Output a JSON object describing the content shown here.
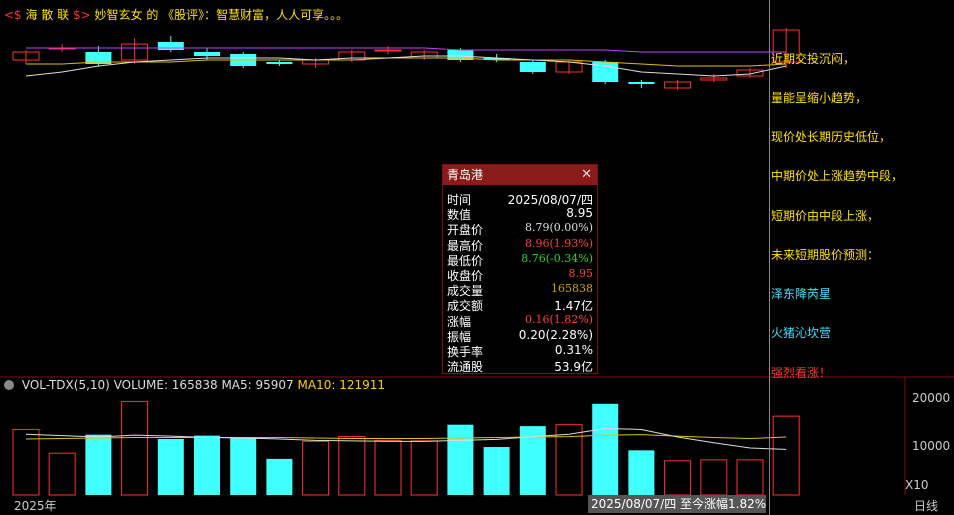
{
  "header": {
    "brand_prefix": "<$ ",
    "brand_text": "海 散 联",
    "brand_suffix": " $>",
    "tagline": "妙智玄女  的 《股评》：智慧财富，人人可享。。。"
  },
  "predictions": [
    {
      "text": "近期交投沉闷，",
      "color": "#ffe000"
    },
    {
      "text": "量能呈缩小趋势，",
      "color": "#ffe000"
    },
    {
      "text": "现价处长期历史低位，",
      "color": "#ffe000"
    },
    {
      "text": "中期价处上涨趋势中段，",
      "color": "#ffe000"
    },
    {
      "text": "短期价由中段上涨，",
      "color": "#ffe000"
    },
    {
      "text": "未来短期股价预测：",
      "color": "#ffe000"
    },
    {
      "text": "泽东降芮星",
      "color": "#40e0ff"
    },
    {
      "text": "火猪沁坎营",
      "color": "#40e0ff"
    },
    {
      "text": "强烈看涨！",
      "color": "#ff3030"
    }
  ],
  "info": {
    "title": "青岛港",
    "close_icon": "close-icon",
    "rows": [
      {
        "k": "时间",
        "v": "2025/08/07/四",
        "color": "#ffffff",
        "sans": true
      },
      {
        "k": "数值",
        "v": "8.95",
        "color": "#ffffff",
        "sans": true
      },
      {
        "k": "开盘价",
        "v": "8.79(0.00%)",
        "color": "#dddddd",
        "sans": false
      },
      {
        "k": "最高价",
        "v": "8.96(1.93%)",
        "color": "#ff4040",
        "sans": false
      },
      {
        "k": "最低价",
        "v": "8.76(-0.34%)",
        "color": "#30d030",
        "sans": false
      },
      {
        "k": "收盘价",
        "v": "8.95",
        "color": "#ff4040",
        "sans": false
      },
      {
        "k": "成交量",
        "v": "165838",
        "color": "#d0a000",
        "sans": false
      },
      {
        "k": "成交额",
        "v": "1.47亿",
        "color": "#ffffff",
        "sans": true
      },
      {
        "k": "涨幅",
        "v": "0.16(1.82%)",
        "color": "#ff4040",
        "sans": false
      },
      {
        "k": "振幅",
        "v": "0.20(2.28%)",
        "color": "#ffffff",
        "sans": true
      },
      {
        "k": "换手率",
        "v": "0.31%",
        "color": "#ffffff",
        "sans": true
      },
      {
        "k": "流通股",
        "v": "53.9亿",
        "color": "#ffffff",
        "sans": true
      }
    ]
  },
  "volume": {
    "indicator": "VOL-TDX(5,10)",
    "volume_label": "VOLUME: 165838",
    "ma5_label": "MA5: 95907",
    "ma10_label": "MA10: 121911",
    "axis": [
      "20000",
      "10000",
      "X10"
    ]
  },
  "footer": {
    "year": "2025年",
    "cursor_info": "2025/08/07/四  至今涨幅1.82%",
    "period": "日线"
  },
  "colors": {
    "up": "#ff3030",
    "down": "#40ffff",
    "ma5": "#dddddd",
    "ma10": "#e0c000",
    "ma_long": "#c040ff"
  },
  "candles": [
    {
      "o": 8.8,
      "c": 8.84,
      "h": 8.85,
      "l": 8.78
    },
    {
      "o": 8.86,
      "c": 8.86,
      "h": 8.88,
      "l": 8.84
    },
    {
      "o": 8.84,
      "c": 8.78,
      "h": 8.87,
      "l": 8.77
    },
    {
      "o": 8.8,
      "c": 8.88,
      "h": 8.91,
      "l": 8.78
    },
    {
      "o": 8.89,
      "c": 8.85,
      "h": 8.92,
      "l": 8.84
    },
    {
      "o": 8.84,
      "c": 8.82,
      "h": 8.86,
      "l": 8.8
    },
    {
      "o": 8.83,
      "c": 8.77,
      "h": 8.84,
      "l": 8.76
    },
    {
      "o": 8.79,
      "c": 8.78,
      "h": 8.8,
      "l": 8.77
    },
    {
      "o": 8.78,
      "c": 8.8,
      "h": 8.81,
      "l": 8.76
    },
    {
      "o": 8.8,
      "c": 8.84,
      "h": 8.85,
      "l": 8.79
    },
    {
      "o": 8.85,
      "c": 8.85,
      "h": 8.87,
      "l": 8.83
    },
    {
      "o": 8.81,
      "c": 8.84,
      "h": 8.85,
      "l": 8.8
    },
    {
      "o": 8.85,
      "c": 8.8,
      "h": 8.86,
      "l": 8.79
    },
    {
      "o": 8.81,
      "c": 8.8,
      "h": 8.83,
      "l": 8.79
    },
    {
      "o": 8.79,
      "c": 8.74,
      "h": 8.8,
      "l": 8.73
    },
    {
      "o": 8.74,
      "c": 8.79,
      "h": 8.8,
      "l": 8.73
    },
    {
      "o": 8.79,
      "c": 8.69,
      "h": 8.8,
      "l": 8.68
    },
    {
      "o": 8.69,
      "c": 8.68,
      "h": 8.7,
      "l": 8.66
    },
    {
      "o": 8.66,
      "c": 8.69,
      "h": 8.7,
      "l": 8.65
    },
    {
      "o": 8.7,
      "c": 8.71,
      "h": 8.73,
      "l": 8.69
    },
    {
      "o": 8.72,
      "c": 8.75,
      "h": 8.76,
      "l": 8.71
    },
    {
      "o": 8.79,
      "c": 8.95,
      "h": 8.96,
      "l": 8.76
    }
  ],
  "volumes": [
    13800,
    8800,
    12700,
    19700,
    11800,
    12500,
    12000,
    7600,
    11300,
    12300,
    11500,
    11400,
    14800,
    10100,
    14500,
    14800,
    19200,
    9400,
    7200,
    7400,
    7400,
    16600
  ],
  "ma5_line": [
    8.72,
    8.74,
    8.77,
    8.79,
    8.8,
    8.81,
    8.81,
    8.81,
    8.8,
    8.81,
    8.81,
    8.82,
    8.82,
    8.81,
    8.8,
    8.79,
    8.77,
    8.74,
    8.73,
    8.72,
    8.73,
    8.77
  ],
  "ma10_line": [
    8.78,
    8.78,
    8.79,
    8.79,
    8.79,
    8.8,
    8.8,
    8.8,
    8.8,
    8.8,
    8.81,
    8.81,
    8.81,
    8.8,
    8.8,
    8.8,
    8.79,
    8.78,
    8.77,
    8.77,
    8.77,
    8.78
  ],
  "malong_line": [
    8.86,
    8.86,
    8.86,
    8.86,
    8.86,
    8.86,
    8.86,
    8.86,
    8.86,
    8.86,
    8.86,
    8.86,
    8.85,
    8.85,
    8.85,
    8.85,
    8.85,
    8.84,
    8.84,
    8.84,
    8.84,
    8.84
  ],
  "vol_ma5": [
    12800,
    12500,
    12200,
    12600,
    12400,
    12100,
    12000,
    11800,
    11500,
    11400,
    11300,
    11300,
    11500,
    11700,
    12300,
    12800,
    14000,
    13800,
    12200,
    11000,
    9900,
    9600
  ],
  "vol_ma10": [
    11800,
    11900,
    12000,
    12100,
    12100,
    12100,
    12100,
    12100,
    12000,
    11900,
    11900,
    11900,
    12000,
    12100,
    12200,
    12300,
    12600,
    12700,
    12400,
    12100,
    11900,
    12200
  ]
}
